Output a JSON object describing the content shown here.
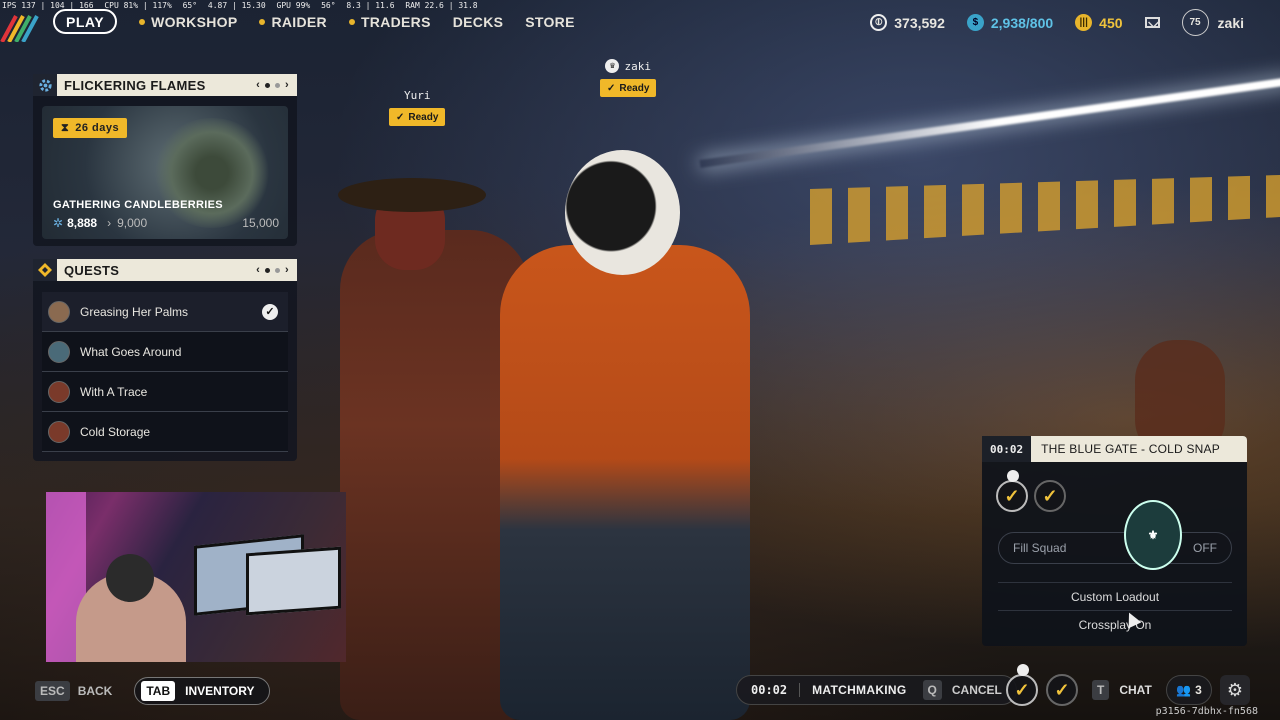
{
  "hud_stats": [
    "IPS 137 | 104 | 166",
    "CPU 81% | 117%",
    "65°",
    "4.87 | 15.30",
    "GPU 99%",
    "56°",
    "8.3 | 11.6",
    "RAM 22.6 | 31.8"
  ],
  "nav": {
    "play": "PLAY",
    "items": [
      "WORKSHOP",
      "RAIDER",
      "TRADERS",
      "DECKS",
      "STORE"
    ]
  },
  "currencies": {
    "coins": "373,592",
    "credits": "2,938/800",
    "tokens": "450"
  },
  "profile": {
    "level": "75",
    "name": "zaki"
  },
  "event_panel": {
    "title": "FLICKERING FLAMES",
    "days": "26 days",
    "name": "GATHERING CANDLEBERRIES",
    "current": "8,888",
    "next": "9,000",
    "max": "15,000"
  },
  "quests_panel": {
    "title": "QUESTS",
    "items": [
      {
        "label": "Greasing Her Palms",
        "done": true
      },
      {
        "label": "What Goes Around",
        "done": false
      },
      {
        "label": "With A Trace",
        "done": false
      },
      {
        "label": "Cold Storage",
        "done": false
      }
    ]
  },
  "players": [
    {
      "name": "Yuri",
      "status": "Ready"
    },
    {
      "name": "zaki",
      "status": "Ready"
    }
  ],
  "matchmaking_popup": {
    "timer": "00:02",
    "title": "THE BLUE GATE - COLD SNAP",
    "fill_squad": "Fill Squad",
    "fill_state": "OFF",
    "custom_loadout": "Custom Loadout",
    "crossplay": "Crossplay On"
  },
  "bottom": {
    "esc_key": "ESC",
    "back": "BACK",
    "tab_key": "TAB",
    "inventory": "INVENTORY",
    "mm_timer": "00:02",
    "matchmaking": "MATCHMAKING",
    "cancel_key": "Q",
    "cancel": "CANCEL",
    "chat_key": "T",
    "chat": "CHAT",
    "party_count": "3"
  },
  "build_id": "p3156-7dbhx-fn568",
  "colors": {
    "accent": "#f0b829",
    "credits": "#5fc2e6"
  }
}
